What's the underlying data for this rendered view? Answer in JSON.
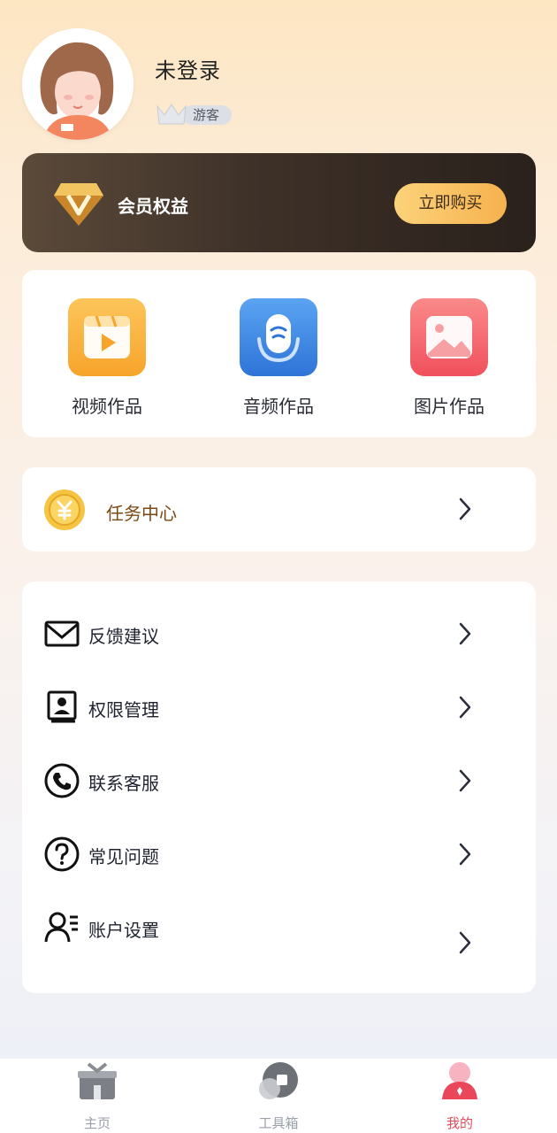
{
  "profile": {
    "username": "未登录",
    "badge": "游客",
    "avatar_icon": "avatar-illustration"
  },
  "vip": {
    "title": "会员权益",
    "buy_label": "立即购买",
    "icon": "diamond-icon"
  },
  "works": [
    {
      "label": "视频作品",
      "icon": "video-icon",
      "color": "#f9b23c"
    },
    {
      "label": "音频作品",
      "icon": "microphone-icon",
      "color": "#3d86e4"
    },
    {
      "label": "图片作品",
      "icon": "image-icon",
      "color": "#f25d66"
    }
  ],
  "task": {
    "label": "任务中心",
    "icon": "coin-icon"
  },
  "menu": [
    {
      "label": "反馈建议",
      "icon": "mail-icon"
    },
    {
      "label": "权限管理",
      "icon": "contact-book-icon"
    },
    {
      "label": "联系客服",
      "icon": "phone-icon"
    },
    {
      "label": "常见问题",
      "icon": "question-icon"
    },
    {
      "label": "账户设置",
      "icon": "user-settings-icon"
    }
  ],
  "tabbar": [
    {
      "label": "主页",
      "icon": "home-icon",
      "active": false
    },
    {
      "label": "工具箱",
      "icon": "toolbox-icon",
      "active": false
    },
    {
      "label": "我的",
      "icon": "profile-icon",
      "active": true
    }
  ],
  "colors": {
    "accent": "#e54b5e",
    "vip_button": "#f6b24e",
    "vip_card": "#3e3128"
  }
}
